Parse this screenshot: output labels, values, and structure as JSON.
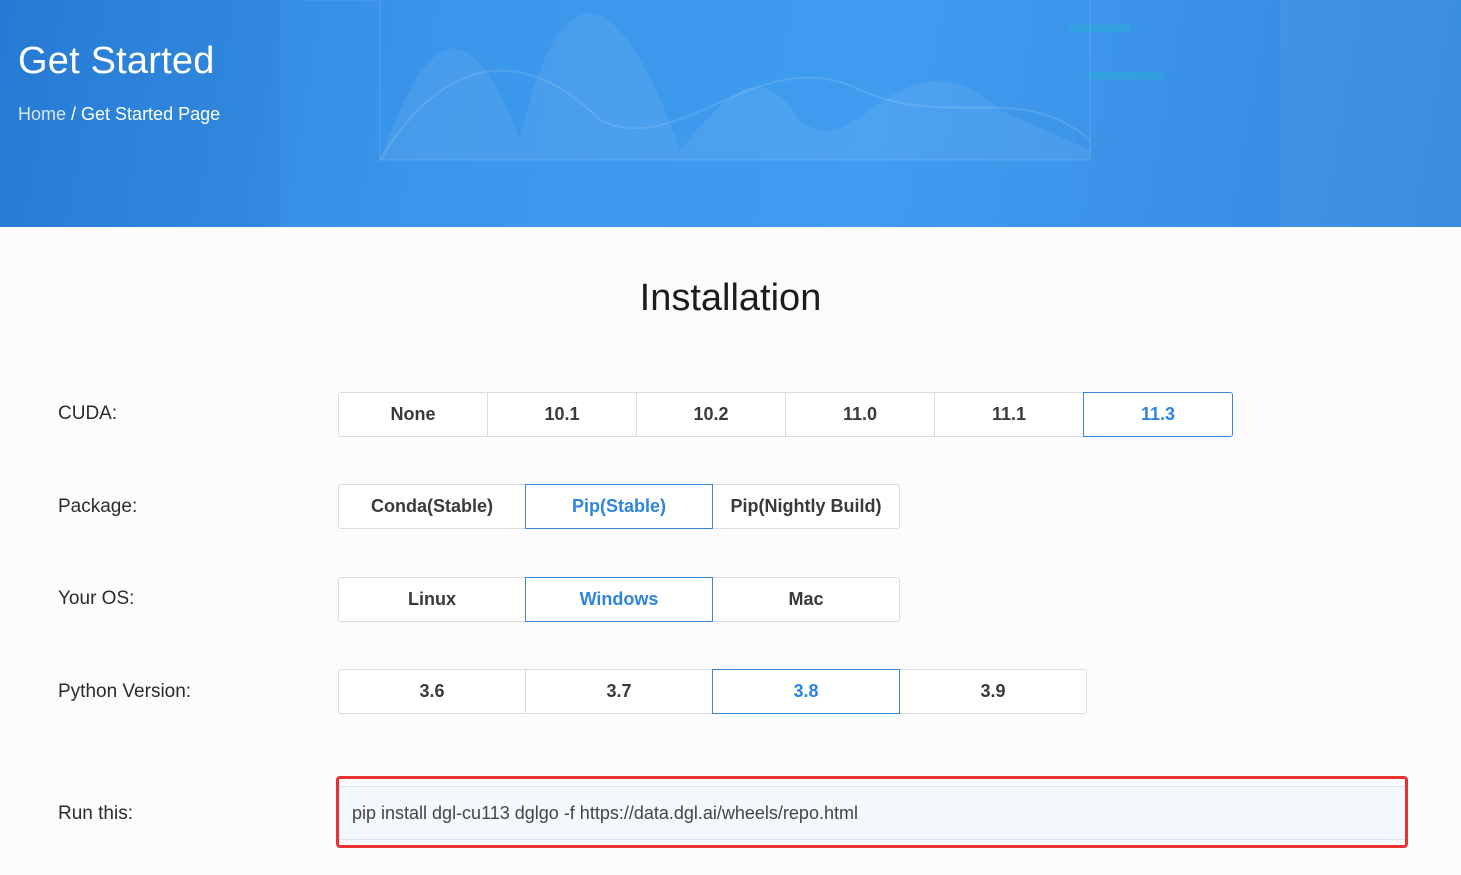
{
  "header": {
    "title": "Get Started",
    "breadcrumb": {
      "home": "Home",
      "separator": " / ",
      "current": "Get Started Page"
    }
  },
  "installation": {
    "title": "Installation",
    "cuda": {
      "label": "CUDA:",
      "options": [
        "None",
        "10.1",
        "10.2",
        "11.0",
        "11.1",
        "11.3"
      ],
      "selected": "11.3"
    },
    "package": {
      "label": "Package:",
      "options": [
        "Conda(Stable)",
        "Pip(Stable)",
        "Pip(Nightly Build)"
      ],
      "selected": "Pip(Stable)"
    },
    "os": {
      "label": "Your OS:",
      "options": [
        "Linux",
        "Windows",
        "Mac"
      ],
      "selected": "Windows"
    },
    "python": {
      "label": "Python Version:",
      "options": [
        "3.6",
        "3.7",
        "3.8",
        "3.9"
      ],
      "selected": "3.8"
    },
    "run": {
      "label": "Run this:",
      "command": "pip install dgl-cu113 dglgo -f https://data.dgl.ai/wheels/repo.html"
    }
  },
  "colors": {
    "hero": "#3a96ea",
    "accent": "#2f84dc",
    "highlight": "#e63232"
  }
}
